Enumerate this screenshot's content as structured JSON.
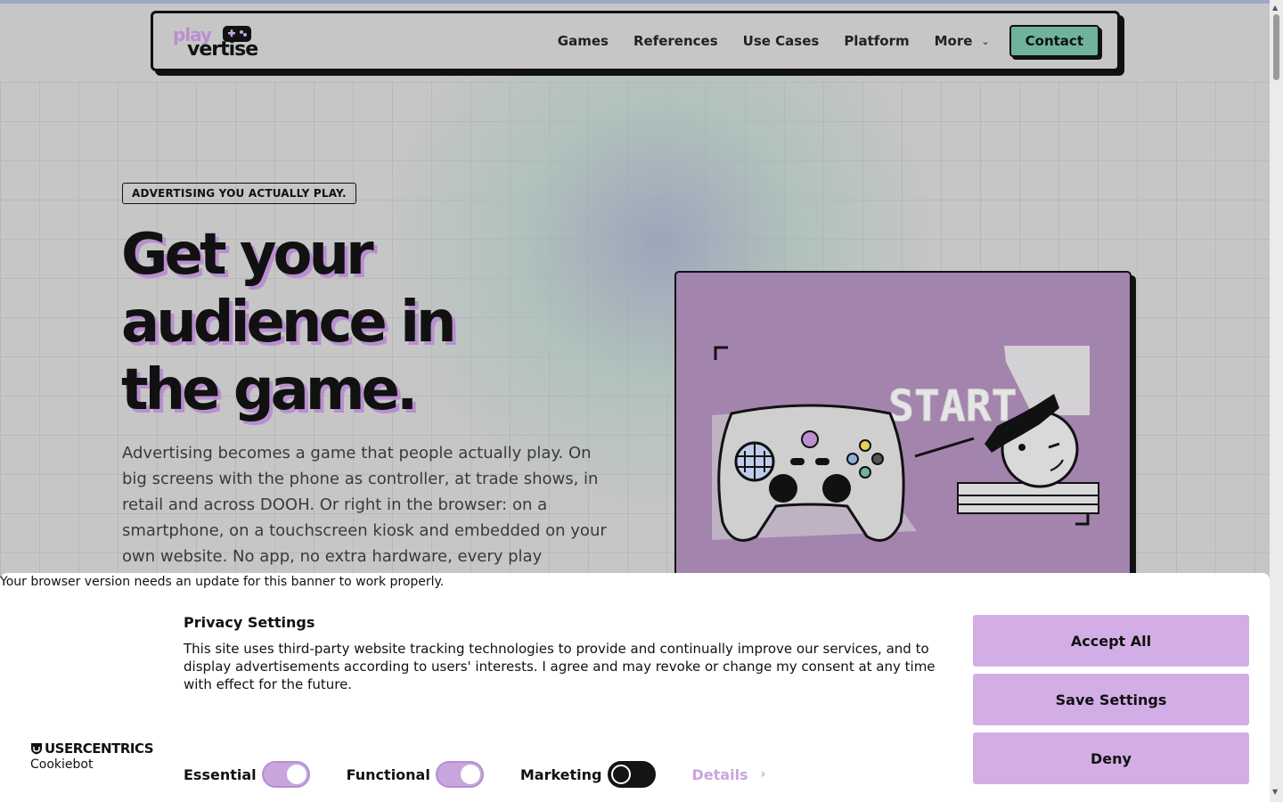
{
  "brand": {
    "logo_top": "play",
    "logo_bottom": "vertise",
    "accent_color": "#b98fd0",
    "contact_color": "#6fb39d"
  },
  "nav": {
    "items": [
      "Games",
      "References",
      "Use Cases",
      "Platform"
    ],
    "more_label": "More",
    "contact_label": "Contact"
  },
  "hero": {
    "tagline": "ADVERTISING YOU ACTUALLY PLAY.",
    "headline_line1": "Get your",
    "headline_line2": "audience in",
    "headline_line3": "the game.",
    "body": "Advertising becomes a game that people actually play. On big screens with the phone as controller, at trade shows, in retail and across DOOH. Or right in the browser: on a smartphone, on a touchscreen kiosk and embedded on your own website. No app, no extra hardware, every play",
    "art_text": "START"
  },
  "cookie_banner": {
    "browser_warning": "Your browser version needs an update for this banner to work properly.",
    "title": "Privacy Settings",
    "description": "This site uses third-party website tracking technologies to provide and continually improve our services, and to display advertisements according to users' interests. I agree and may revoke or change my consent at any time with effect for the future.",
    "provider_brand": "USERCENTRICS",
    "provider_sub": "Cookiebot",
    "toggles": [
      {
        "label": "Essential",
        "state": "on"
      },
      {
        "label": "Functional",
        "state": "on"
      },
      {
        "label": "Marketing",
        "state": "off"
      }
    ],
    "details_label": "Details",
    "accept_all_label": "Accept All",
    "save_settings_label": "Save Settings",
    "deny_label": "Deny",
    "button_color": "#d3aee6"
  }
}
